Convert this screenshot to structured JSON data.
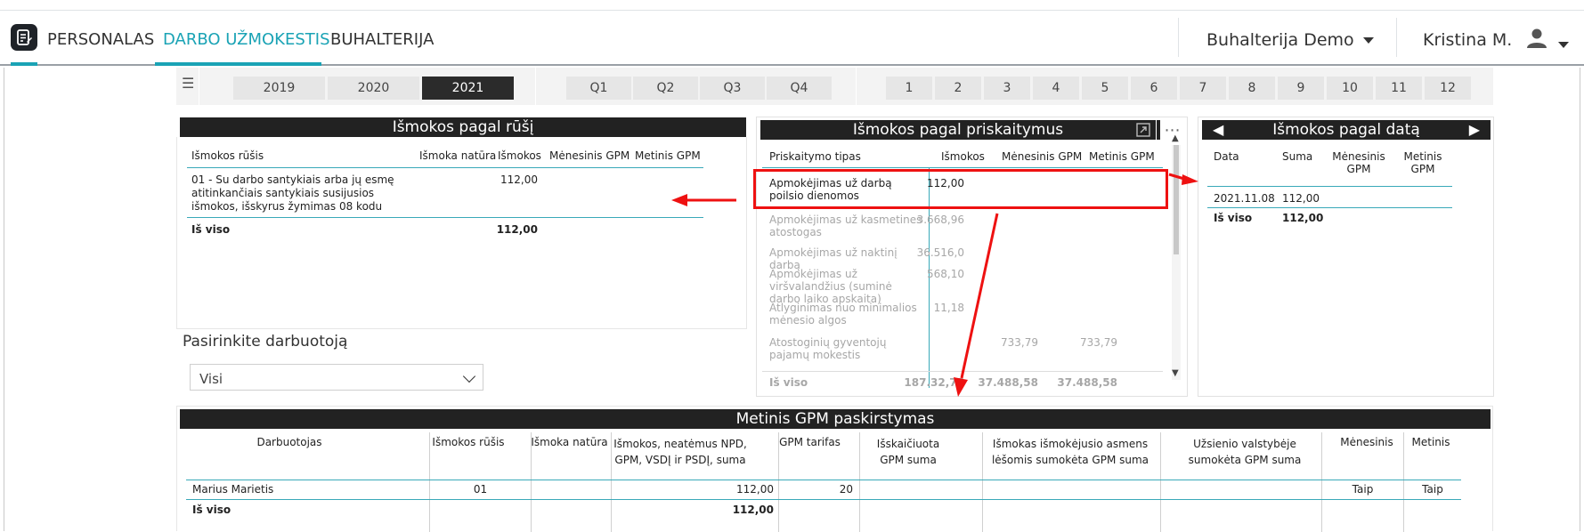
{
  "nav": {
    "links": [
      "PERSONALAS",
      "DARBO UŽMOKESTIS",
      "BUHALTERIJA"
    ],
    "company": "Buhalterija Demo",
    "user": "Kristina M."
  },
  "filters": {
    "years": [
      "2019",
      "2020",
      "2021"
    ],
    "selected_year": "2021",
    "quarters": [
      "Q1",
      "Q2",
      "Q3",
      "Q4"
    ],
    "months": [
      "1",
      "2",
      "3",
      "4",
      "5",
      "6",
      "7",
      "8",
      "9",
      "10",
      "11",
      "12"
    ]
  },
  "panel_left": {
    "title": "Išmokos pagal rūšį",
    "headers": [
      "Išmokos rūšis",
      "Išmoka natūra",
      "Išmokos",
      "Mėnesinis GPM",
      "Metinis GPM"
    ],
    "row": {
      "type": "01 - Su darbo santykiais arba jų esmę atitinkančiais santykiais susijusios išmokos, išskyrus žymimas 08 kodu",
      "amount": "112,00"
    },
    "total_label": "Iš viso",
    "total_amount": "112,00"
  },
  "employee_filter": {
    "label": "Pasirinkite darbuotoją",
    "value": "Visi"
  },
  "panel_middle": {
    "title": "Išmokos pagal priskaitymus",
    "headers": [
      "Priskaitymo tipas",
      "Išmokos",
      "Mėnesinis GPM",
      "Metinis GPM"
    ],
    "rows": [
      {
        "type": "Apmokėjimas už darbą poilsio dienomos",
        "amount": "112,00",
        "mgpm": "",
        "ygpm": ""
      },
      {
        "type": "Apmokėjimas už kasmetines atostogas",
        "amount": "3.668,96",
        "mgpm": "",
        "ygpm": ""
      },
      {
        "type": "Apmokėjimas už naktinį darbą",
        "amount": "36.516,0",
        "mgpm": "",
        "ygpm": ""
      },
      {
        "type": "Apmokėjimas už viršvalandžius (suminė darbo laiko apskaita)",
        "amount": "568,10",
        "mgpm": "",
        "ygpm": ""
      },
      {
        "type": "Atlyginimas nuo minimalios mėnesio algos",
        "amount": "11,18",
        "mgpm": "",
        "ygpm": ""
      },
      {
        "type": "Atostoginių gyventojų pajamų mokestis",
        "amount": "",
        "mgpm": "733,79",
        "ygpm": "733,79"
      }
    ],
    "total_label": "Iš viso",
    "total_amount": "187.32,75",
    "total_mgpm": "37.488,58",
    "total_ygpm": "37.488,58"
  },
  "panel_right": {
    "title": "Išmokos pagal datą",
    "headers": [
      "Data",
      "Suma",
      "Mėnesinis GPM",
      "Metinis GPM"
    ],
    "row": {
      "date": "2021.11.08",
      "sum": "112,00"
    },
    "total_label": "Iš viso",
    "total_amount": "112,00"
  },
  "panel_bottom": {
    "title": "Metinis GPM paskirstymas",
    "headers": [
      "Darbuotojas",
      "Išmokos rūšis",
      "Išmoka natūra",
      "Išmokos, neatėmus NPD, GPM, VSDĮ ir PSDĮ, suma",
      "GPM tarifas",
      "Išskaičiuota GPM suma",
      "Išmokas išmokėjusio asmens lėšomis sumokėta GPM suma",
      "Užsienio valstybėje sumokėta GPM suma",
      "Mėnesinis",
      "Metinis"
    ],
    "row": {
      "employee": "Marius Marietis",
      "type": "01",
      "natura": "",
      "amount": "112,00",
      "rate": "20",
      "monthly": "Taip",
      "yearly": "Taip"
    },
    "total_label": "Iš viso",
    "total_amount": "112,00"
  },
  "colors": {
    "accent": "#1aa3b5",
    "title_bar": "#222222",
    "highlight": "#e11111"
  }
}
